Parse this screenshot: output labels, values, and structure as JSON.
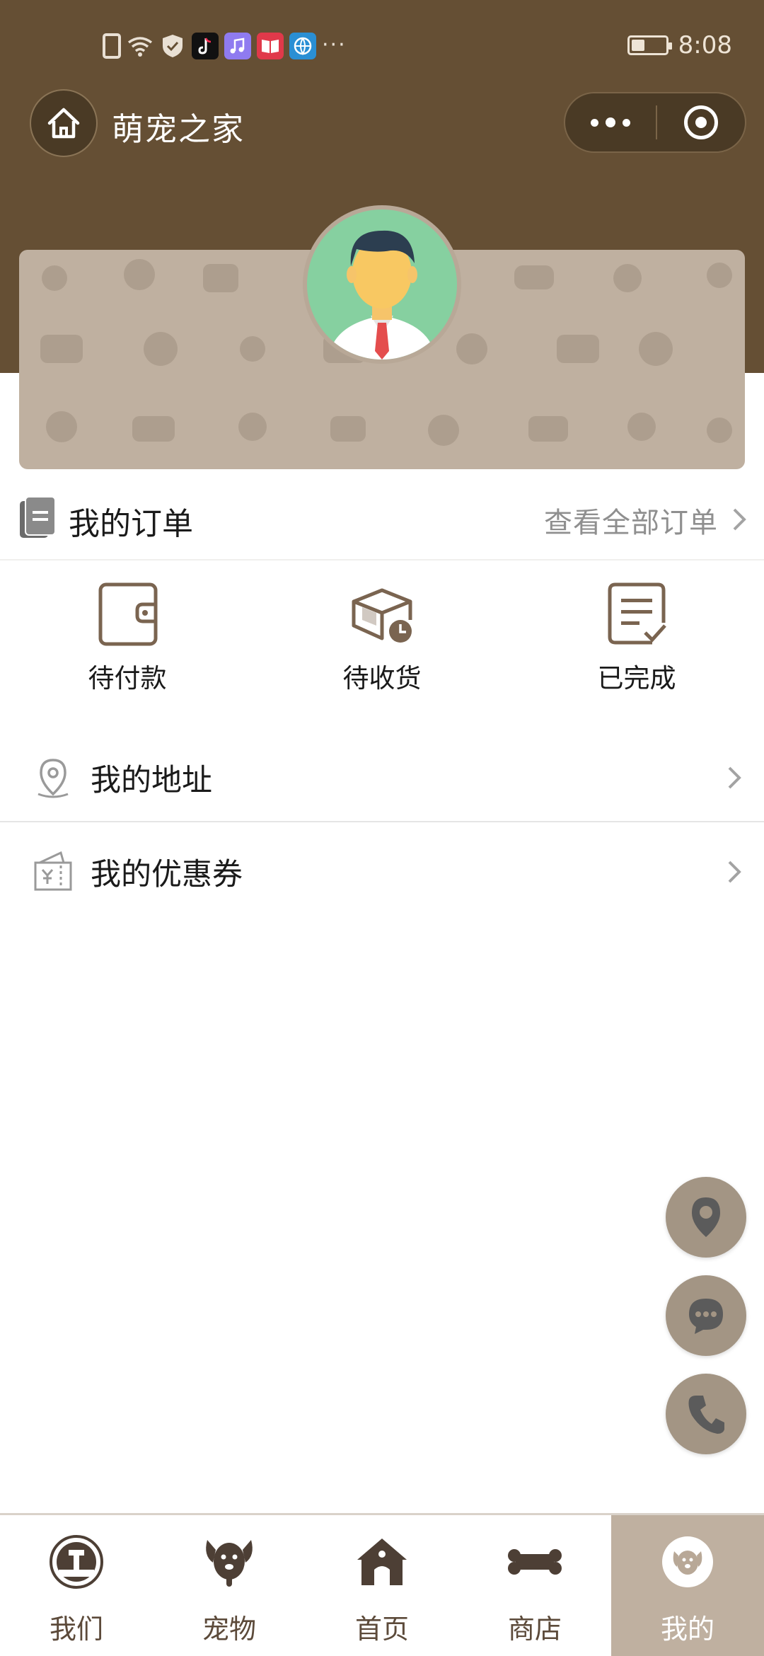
{
  "status_bar": {
    "time": "8:08",
    "icons": [
      "sim-alert-icon",
      "wifi-icon",
      "shield-icon",
      "tiktok-app-icon",
      "music-app-icon",
      "book-app-icon",
      "browser-app-icon"
    ],
    "more": "···"
  },
  "nav": {
    "title": "萌宠之家",
    "home_icon": "home-icon",
    "more_icon": "more-dots-icon",
    "close_icon": "target-icon"
  },
  "colors": {
    "header_brown": "#654f34",
    "card_beige": "#bfb0a0",
    "accent": "#7a6450"
  },
  "orders": {
    "title": "我的订单",
    "view_all": "查看全部订单",
    "statuses": [
      {
        "label": "待付款",
        "icon": "wallet-icon"
      },
      {
        "label": "待收货",
        "icon": "package-clock-icon"
      },
      {
        "label": "已完成",
        "icon": "checklist-icon"
      }
    ]
  },
  "menu": {
    "address": {
      "label": "我的地址",
      "icon": "location-pin-icon"
    },
    "coupon": {
      "label": "我的优惠券",
      "icon": "coupon-icon"
    }
  },
  "fabs": [
    "location-icon",
    "chat-icon",
    "phone-icon"
  ],
  "tabs": [
    {
      "label": "我们",
      "icon": "brand-badge-icon",
      "active": false
    },
    {
      "label": "宠物",
      "icon": "dog-head-icon",
      "active": false
    },
    {
      "label": "首页",
      "icon": "dog-house-icon",
      "active": false
    },
    {
      "label": "商店",
      "icon": "bone-icon",
      "active": false
    },
    {
      "label": "我的",
      "icon": "dog-face-icon",
      "active": true
    }
  ]
}
